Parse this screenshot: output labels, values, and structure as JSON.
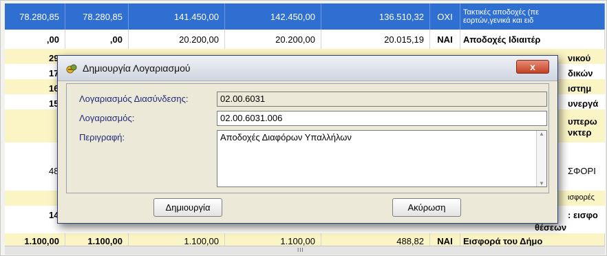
{
  "background_grid": {
    "rows": [
      {
        "values": [
          "78.280,85",
          "78.280,85",
          "141.450,00",
          "142.450,00",
          "136.510,32"
        ],
        "flag": "ΟΧΙ",
        "desc_line1": "Τακτικές αποδοχές (πε",
        "desc_line2": "εορτών,γενικά και ειδ"
      },
      {
        "values": [
          ",00",
          ",00",
          "20.200,00",
          "20.200,00",
          "20.015,19"
        ],
        "flag": "ΝΑΙ",
        "desc_line1": "Αποδοχές Ιδιαιτέρ"
      }
    ],
    "cut_left": [
      "29",
      "17",
      "16",
      "15",
      "48",
      "14"
    ],
    "cut_right": [
      "νικού",
      "δικών",
      "ιστημ",
      "υνεργά",
      "υπερω",
      "νκτερ",
      "ΣΦΟΡΙ",
      "ισφορές",
      ": εισφο",
      "θέσεων"
    ],
    "last_row": {
      "values": [
        "1.100,00",
        "1.100,00",
        "1.100,00",
        "1.100,00",
        "488,82"
      ],
      "flag": "ΝΑΙ",
      "desc": "Εισφορά του Δήμο"
    },
    "scroll_grip": "III"
  },
  "dialog": {
    "title": "Δημιουργία Λογαριασμού",
    "close_label": "x",
    "fields": {
      "link_account": {
        "label": "Λογαριασμός Διασύνδεσης:",
        "value": "02.00.6031"
      },
      "account": {
        "label": "Λογαριασμός:",
        "value": "02.00.6031.006"
      },
      "description": {
        "label": "Περιγραφή:",
        "value": "Αποδοχές Διαφόρων Υπαλλήλων"
      }
    },
    "buttons": {
      "create": "Δημιουργία",
      "cancel": "Ακύρωση"
    }
  }
}
